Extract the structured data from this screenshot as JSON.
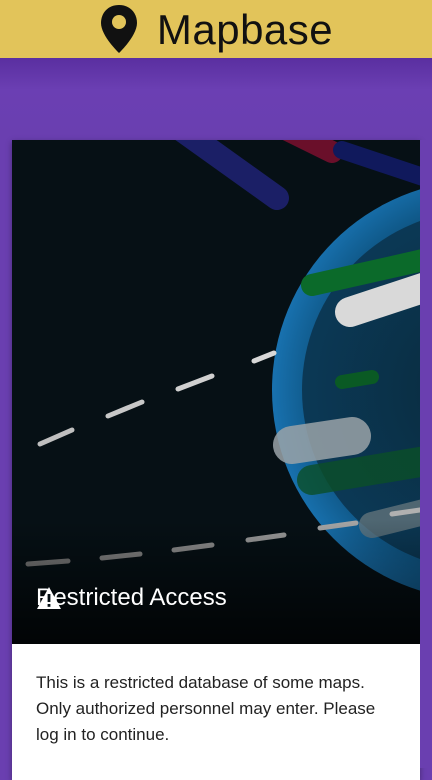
{
  "header": {
    "title": "Mapbase",
    "icon": "map-pin-icon",
    "background_color": "#e2c45a"
  },
  "card": {
    "hero_icon": "warning-icon",
    "hero_title": "Restricted Access",
    "body_text": "This is a restricted database of some maps. Only authorized personnel may enter. Please log in to continue."
  },
  "colors": {
    "accent_purple": "#6a3fb0",
    "hero_background": "#061015"
  }
}
